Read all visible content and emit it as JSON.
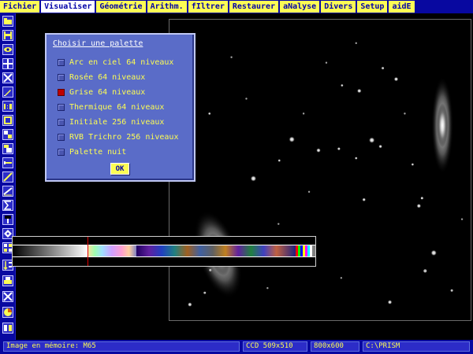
{
  "menu": {
    "items": [
      {
        "label": "Fichier"
      },
      {
        "label": "Visualiser"
      },
      {
        "label": "Géométrie"
      },
      {
        "label": "Arithm."
      },
      {
        "label": "fIltrer"
      },
      {
        "label": "Restaurer"
      },
      {
        "label": "aNalyse"
      },
      {
        "label": "Divers"
      },
      {
        "label": "Setup"
      },
      {
        "label": "aidE"
      }
    ],
    "active_index": 1
  },
  "toolbar": {
    "icons": [
      "open-icon",
      "save-icon",
      "eye-icon",
      "crosshair-icon",
      "expand-arrows-icon",
      "pencil-icon",
      "ratio-icon",
      "select-icon",
      "blocks-icon",
      "layers-icon",
      "line-icon",
      "slope-icon",
      "ruler-icon",
      "sigma-icon",
      "flag-icon",
      "target-icon",
      "grid-icon",
      "sort-icon",
      "print-icon",
      "close-icon",
      "colorwheel-icon",
      "book-icon"
    ]
  },
  "palette_dialog": {
    "title": "Choisir une palette",
    "options": [
      {
        "label": "Arc en ciel 64 niveaux",
        "checked": false
      },
      {
        "label": "Rosée 64 niveaux",
        "checked": false
      },
      {
        "label": "Grise 64 niveaux",
        "checked": true
      },
      {
        "label": "Thermique 64 niveaux",
        "checked": false
      },
      {
        "label": "Initiale 256 niveaux",
        "checked": false
      },
      {
        "label": "RVB Trichro 256 niveaux",
        "checked": false
      },
      {
        "label": "Palette nuit",
        "checked": false
      }
    ],
    "ok_label": "OK"
  },
  "status": {
    "image": "Image en mémoire: M65",
    "ccd": "CCD 509x510",
    "resolution": "800x600",
    "path": "C:\\PRISM"
  },
  "colors": {
    "menubar_bg": "#0808a0",
    "menu_item_bg": "#fcfc54",
    "menu_item_text": "#0000a8",
    "dialog_bg": "#5a6cc8",
    "dialog_option_text": "#fcfc54",
    "checked_box": "#c00000",
    "colormap_cursor": "#e00000"
  }
}
